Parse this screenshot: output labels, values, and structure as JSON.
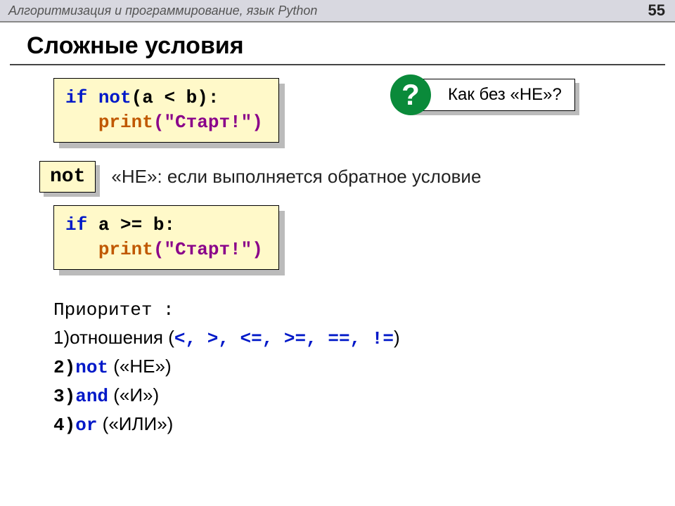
{
  "header": {
    "title": "Алгоритмизация и программирование, язык Python",
    "page": "55"
  },
  "slide_title": "Сложные условия",
  "code1": {
    "if": "if",
    "not_kw": "not",
    "cond": "(a < b):",
    "indent": "   ",
    "print": "print",
    "args": "(\"Старт!\")"
  },
  "callout": {
    "q": "?",
    "text": "Как без «НЕ»?"
  },
  "not_badge": "not",
  "not_desc": "«НЕ»: если выполняется обратное условие",
  "code2": {
    "if": "if",
    "cond": " a >= b:",
    "indent": "   ",
    "print": "print",
    "args": "(\"Старт!\")"
  },
  "priority": {
    "header": "Приоритет :",
    "l1_pre": "1)отношения (",
    "l1_ops": "<, >, <=, >=, ==, !=",
    "l1_post": ")",
    "l2_num": "2)",
    "l2_kw": "not",
    "l2_post": " («НЕ»)",
    "l3_num": "3)",
    "l3_kw": "and",
    "l3_post": " («И»)",
    "l4_num": "4)",
    "l4_kw": "or",
    "l4_post": " («ИЛИ»)"
  }
}
